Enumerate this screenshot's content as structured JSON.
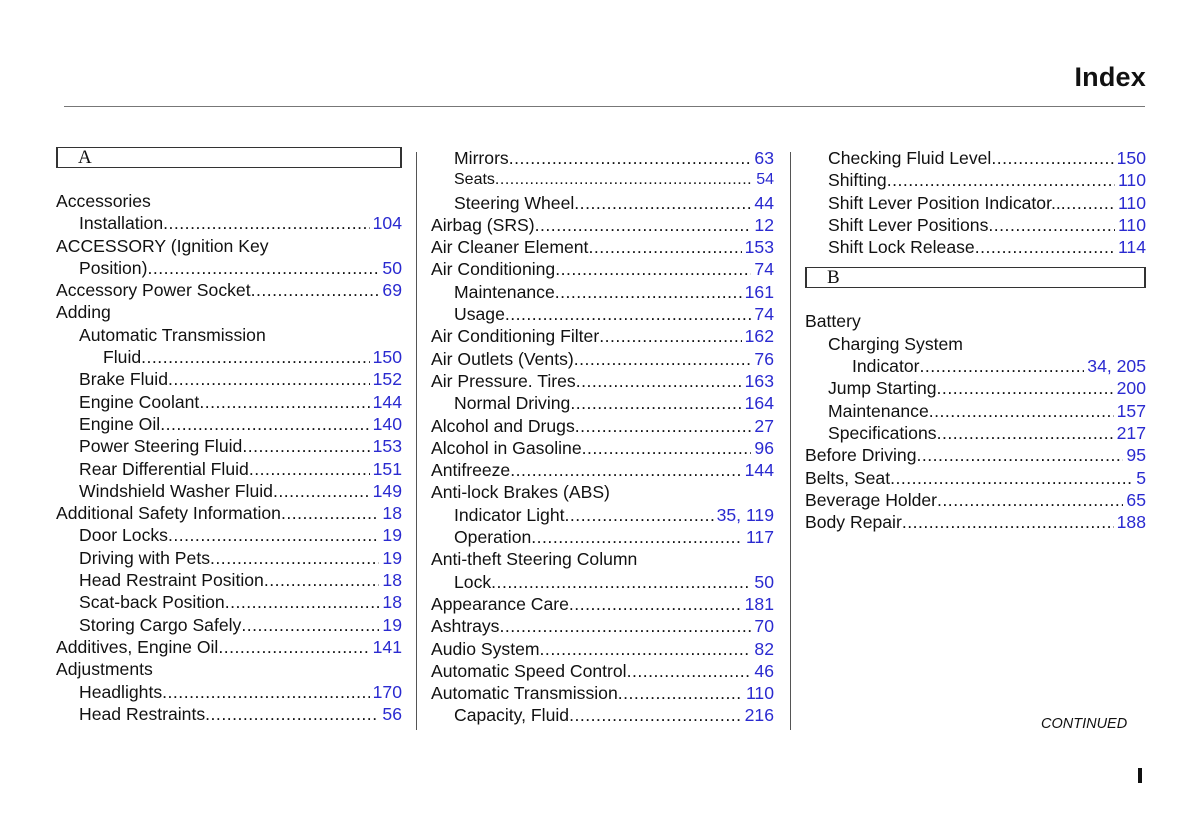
{
  "header": {
    "title": "Index"
  },
  "footer": {
    "continued": "CONTINUED",
    "page_marker": "I"
  },
  "columns": [
    {
      "section_letter": "A",
      "entries": [
        {
          "text": "Accessories",
          "level": 0,
          "pages": ""
        },
        {
          "text": "Installation",
          "level": 1,
          "pages": "104"
        },
        {
          "text": "ACCESSORY  (Ignition Key",
          "level": 0,
          "pages": ""
        },
        {
          "text": "Position)",
          "level": 1,
          "pages": "50"
        },
        {
          "text": "Accessory Power Socket",
          "level": 0,
          "pages": "69"
        },
        {
          "text": "Adding",
          "level": 0,
          "pages": ""
        },
        {
          "text": "Automatic  Transmission",
          "level": 1,
          "pages": ""
        },
        {
          "text": "Fluid",
          "level": 2,
          "pages": "150"
        },
        {
          "text": "Brake Fluid",
          "level": 1,
          "pages": "152"
        },
        {
          "text": "Engine Coolant",
          "level": 1,
          "pages": "144"
        },
        {
          "text": "Engine Oil",
          "level": 1,
          "pages": "140"
        },
        {
          "text": "Power Steering Fluid",
          "level": 1,
          "pages": "153"
        },
        {
          "text": "Rear Differential Fluid",
          "level": 1,
          "pages": "151"
        },
        {
          "text": "Windshield Washer Fluid",
          "level": 1,
          "pages": "149"
        },
        {
          "text": "Additional Safety Information",
          "level": 0,
          "pages": "18"
        },
        {
          "text": "Door Locks",
          "level": 1,
          "pages": "19"
        },
        {
          "text": "Driving with Pets",
          "level": 1,
          "pages": "19"
        },
        {
          "text": "Head Restraint Position",
          "level": 1,
          "pages": "18"
        },
        {
          "text": "Scat-back Position",
          "level": 1,
          "pages": "18"
        },
        {
          "text": "Storing Cargo Safely",
          "level": 1,
          "pages": "19"
        },
        {
          "text": "Additives, Engine Oil",
          "level": 0,
          "pages": "141"
        },
        {
          "text": "Adjustments",
          "level": 0,
          "pages": ""
        },
        {
          "text": "Headlights",
          "level": 1,
          "pages": "170"
        },
        {
          "text": "Head Restraints",
          "level": 1,
          "pages": "56"
        }
      ]
    },
    {
      "section_letter": "",
      "entries": [
        {
          "text": "Mirrors",
          "level": 1,
          "pages": "63"
        },
        {
          "text": "Seats",
          "level": 1,
          "pages": "54",
          "small": true
        },
        {
          "text": "Steering Wheel",
          "level": 1,
          "pages": "44"
        },
        {
          "text": "Airbag (SRS)",
          "level": 0,
          "pages": "12"
        },
        {
          "text": "Air Cleaner Element",
          "level": 0,
          "pages": "153"
        },
        {
          "text": "Air Conditioning",
          "level": 0,
          "pages": "74"
        },
        {
          "text": "Maintenance",
          "level": 1,
          "pages": "161"
        },
        {
          "text": "Usage",
          "level": 1,
          "pages": "74"
        },
        {
          "text": "Air Conditioning Filter",
          "level": 0,
          "pages": "162"
        },
        {
          "text": "Air Outlets  (Vents)",
          "level": 0,
          "pages": "76"
        },
        {
          "text": "Air Pressure. Tires",
          "level": 0,
          "pages": "163"
        },
        {
          "text": "Normal Driving",
          "level": 1,
          "pages": "164"
        },
        {
          "text": "Alcohol and Drugs",
          "level": 0,
          "pages": "27"
        },
        {
          "text": "Alcohol in Gasoline",
          "level": 0,
          "pages": "96"
        },
        {
          "text": "Antifreeze",
          "level": 0,
          "pages": "144"
        },
        {
          "text": "Anti-lock Brakes (ABS)",
          "level": 0,
          "pages": ""
        },
        {
          "text": "Indicator  Light",
          "level": 1,
          "pages": "35, 119"
        },
        {
          "text": "Operation",
          "level": 1,
          "pages": "117"
        },
        {
          "text": "Anti-theft Steering Column",
          "level": 0,
          "pages": ""
        },
        {
          "text": "Lock",
          "level": 1,
          "pages": "50"
        },
        {
          "text": "Appearance Care",
          "level": 0,
          "pages": "181"
        },
        {
          "text": "Ashtrays",
          "level": 0,
          "pages": "70"
        },
        {
          "text": "Audio System",
          "level": 0,
          "pages": "82"
        },
        {
          "text": "Automatic Speed Control",
          "level": 0,
          "pages": "46"
        },
        {
          "text": "Automatic Transmission",
          "level": 0,
          "pages": "110"
        },
        {
          "text": "Capacity, Fluid",
          "level": 1,
          "pages": "216"
        }
      ]
    },
    {
      "section_letter": "B",
      "pre_entries": [
        {
          "text": "Checking Fluid Level",
          "level": 1,
          "pages": "150"
        },
        {
          "text": "Shifting",
          "level": 1,
          "pages": "110"
        },
        {
          "text": "Shift Lever Position Indicator..",
          "level": 1,
          "pages": "110"
        },
        {
          "text": "Shift Lever Positions",
          "level": 1,
          "pages": "110"
        },
        {
          "text": "Shift Lock Release",
          "level": 1,
          "pages": "114"
        }
      ],
      "entries": [
        {
          "text": "Battery",
          "level": 0,
          "pages": ""
        },
        {
          "text": "Charging System",
          "level": 1,
          "pages": ""
        },
        {
          "text": "Indicator",
          "level": 2,
          "pages": "34, 205"
        },
        {
          "text": "Jump Starting",
          "level": 1,
          "pages": "200"
        },
        {
          "text": "Maintenance",
          "level": 1,
          "pages": "157"
        },
        {
          "text": "Specifications",
          "level": 1,
          "pages": "217"
        },
        {
          "text": "Before Driving",
          "level": 0,
          "pages": "95"
        },
        {
          "text": "Belts, Seat",
          "level": 0,
          "pages": "5"
        },
        {
          "text": "Beverage Holder",
          "level": 0,
          "pages": "65"
        },
        {
          "text": "Body Repair",
          "level": 0,
          "pages": "188"
        }
      ]
    }
  ]
}
